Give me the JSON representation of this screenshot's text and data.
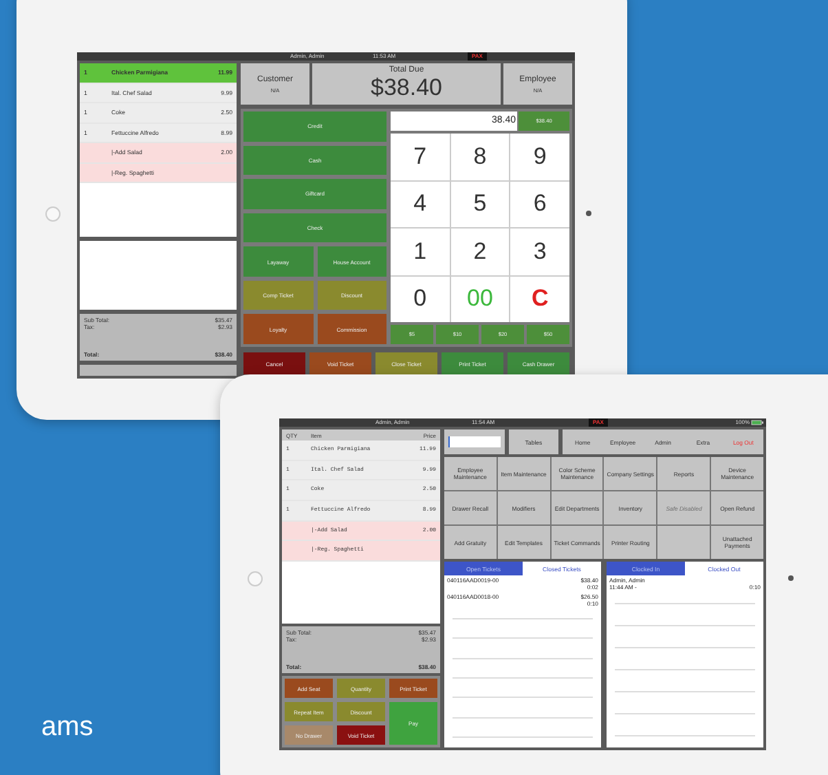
{
  "caption": "ams",
  "payment_screen": {
    "status": {
      "user": "Admin, Admin",
      "time": "11:53 AM",
      "badge": "PAX"
    },
    "order_items": [
      {
        "qty": "1",
        "name": "Chicken Parmigiana",
        "price": "11.99",
        "kind": "item",
        "selected": true
      },
      {
        "qty": "1",
        "name": "Ital. Chef Salad",
        "price": "9.99",
        "kind": "item",
        "selected": false
      },
      {
        "qty": "1",
        "name": "Coke",
        "price": "2.50",
        "kind": "item",
        "selected": false
      },
      {
        "qty": "1",
        "name": "Fettuccine Alfredo",
        "price": "8.99",
        "kind": "item",
        "selected": false
      },
      {
        "name": "|-Add Salad",
        "price": "2.00",
        "kind": "modifier",
        "selected": false
      },
      {
        "name": "|-Reg. Spaghetti",
        "kind": "modifier",
        "selected": false
      }
    ],
    "totals": [
      {
        "label": "Sub Total:",
        "value": "$35.47"
      },
      {
        "label": "Tax:",
        "value": "$2.93"
      },
      {
        "label": "Total:",
        "value": "$38.40",
        "kind": "grand"
      }
    ],
    "header": {
      "customer_label": "Customer",
      "customer_value": "N/A",
      "total_label": "Total Due",
      "total_value": "$38.40",
      "employee_label": "Employee",
      "employee_value": "N/A"
    },
    "payment_buttons": [
      {
        "label": "Credit",
        "color": "#3d8b3d",
        "kind": "wide"
      },
      {
        "label": "Cash",
        "color": "#3d8b3d",
        "kind": "wide"
      },
      {
        "label": "Giftcard",
        "color": "#3d8b3d",
        "kind": "wide"
      },
      {
        "label": "Check",
        "color": "#3d8b3d",
        "kind": "wide"
      },
      {
        "label": "Layaway",
        "color": "#3d8b3d",
        "kind": "half"
      },
      {
        "label": "House Account",
        "color": "#3d8b3d",
        "kind": "half"
      },
      {
        "label": "Comp Ticket",
        "color": "#8a8a2e",
        "kind": "half"
      },
      {
        "label": "Discount",
        "color": "#8a8a2e",
        "kind": "half"
      },
      {
        "label": "Loyalty",
        "color": "#9a4a1e",
        "kind": "half"
      },
      {
        "label": "Commission",
        "color": "#9a4a1e",
        "kind": "half"
      }
    ],
    "keypad": {
      "display": "38.40",
      "quick_amount": "$38.40",
      "keys": [
        {
          "label": "7",
          "kind": "digit"
        },
        {
          "label": "8",
          "kind": "digit"
        },
        {
          "label": "9",
          "kind": "digit"
        },
        {
          "label": "4",
          "kind": "digit"
        },
        {
          "label": "5",
          "kind": "digit"
        },
        {
          "label": "6",
          "kind": "digit"
        },
        {
          "label": "1",
          "kind": "digit"
        },
        {
          "label": "2",
          "kind": "digit"
        },
        {
          "label": "3",
          "kind": "digit"
        },
        {
          "label": "0",
          "kind": "digit"
        },
        {
          "label": "00",
          "kind": "double"
        },
        {
          "label": "C",
          "kind": "clear"
        }
      ],
      "presets": [
        "$5",
        "$10",
        "$20",
        "$50"
      ]
    },
    "actions": [
      {
        "label": "Cancel",
        "color": "#7a1010"
      },
      {
        "label": "Void Ticket",
        "color": "#9a4a1e"
      },
      {
        "label": "Close Ticket",
        "color": "#8a8a2e"
      },
      {
        "label": "Print Ticket",
        "color": "#3d8b3d"
      },
      {
        "label": "Cash Drawer",
        "color": "#3d8b3d"
      }
    ]
  },
  "main_screen": {
    "status": {
      "user": "Admin, Admin",
      "time": "11:54 AM",
      "badge": "PAX",
      "battery": "100%"
    },
    "columns": [
      "QTY",
      "Item",
      "Price"
    ],
    "order_items": [
      {
        "qty": "1",
        "name": "Chicken Parmigiana",
        "price": "11.99",
        "kind": "item"
      },
      {
        "qty": "1",
        "name": "Ital. Chef Salad",
        "price": "9.99",
        "kind": "item"
      },
      {
        "qty": "1",
        "name": "Coke",
        "price": "2.50",
        "kind": "item"
      },
      {
        "qty": "1",
        "name": "Fettuccine Alfredo",
        "price": "8.99",
        "kind": "item"
      },
      {
        "name": "|-Add Salad",
        "price": "2.00",
        "kind": "modifier"
      },
      {
        "name": "|-Reg. Spaghetti",
        "kind": "modifier"
      }
    ],
    "totals": [
      {
        "label": "Sub Total:",
        "value": "$35.47"
      },
      {
        "label": "Tax:",
        "value": "$2.93"
      },
      {
        "label": "Total:",
        "value": "$38.40",
        "kind": "grand"
      }
    ],
    "ticket_buttons": [
      {
        "label": "Add Seat",
        "color": "#9a4a1e",
        "kind": "normal"
      },
      {
        "label": "Quantity",
        "color": "#8a8a2e",
        "kind": "normal"
      },
      {
        "label": "Print Ticket",
        "color": "#9a4a1e",
        "kind": "normal"
      },
      {
        "label": "Repeat Item",
        "color": "#8a8a2e",
        "kind": "normal"
      },
      {
        "label": "Discount",
        "color": "#8a8a2e",
        "kind": "normal"
      },
      {
        "label": "Pay",
        "color": "#3fa33f",
        "kind": "tall"
      },
      {
        "label": "No Drawer",
        "color": "#a8896a",
        "kind": "normal"
      },
      {
        "label": "Void Ticket",
        "color": "#8a1010",
        "kind": "normal"
      }
    ],
    "tables_button": "Tables",
    "nav": [
      {
        "label": "Home",
        "kind": "normal"
      },
      {
        "label": "Employee",
        "kind": "normal"
      },
      {
        "label": "Admin",
        "kind": "normal"
      },
      {
        "label": "Extra",
        "kind": "normal"
      },
      {
        "label": "Log Out",
        "kind": "danger"
      }
    ],
    "functions": [
      {
        "label": "Employee Maintenance",
        "kind": "button",
        "disabled": false
      },
      {
        "label": "Item Maintenance",
        "kind": "button",
        "disabled": false
      },
      {
        "label": "Color Scheme Maintenance",
        "kind": "button",
        "disabled": false
      },
      {
        "label": "Company Settings",
        "kind": "button",
        "disabled": false
      },
      {
        "label": "Reports",
        "kind": "button",
        "disabled": false
      },
      {
        "label": "Device Maintenance",
        "kind": "button",
        "disabled": false
      },
      {
        "label": "Drawer Recall",
        "kind": "button",
        "disabled": false
      },
      {
        "label": "Modifiers",
        "kind": "button",
        "disabled": false
      },
      {
        "label": "Edit Departments",
        "kind": "button",
        "disabled": false
      },
      {
        "label": "Inventory",
        "kind": "button",
        "disabled": false
      },
      {
        "label": "Safe Disabled",
        "kind": "button",
        "disabled": true
      },
      {
        "label": "Open Refund",
        "kind": "button",
        "disabled": false
      },
      {
        "label": "Add Gratuity",
        "kind": "button",
        "disabled": false
      },
      {
        "label": "Edit Templates",
        "kind": "button",
        "disabled": false
      },
      {
        "label": "Ticket Commands",
        "kind": "button",
        "disabled": false
      },
      {
        "label": "Printer Routing",
        "kind": "button",
        "disabled": false
      },
      {
        "kind": "empty"
      },
      {
        "label": "Unattached Payments",
        "kind": "button",
        "disabled": false
      }
    ],
    "ticket_tabs": [
      {
        "label": "Open Tickets",
        "selected": true
      },
      {
        "label": "Closed Tickets",
        "selected": false
      }
    ],
    "tickets": [
      {
        "id": "040116AAD0019-00",
        "amount": "$38.40",
        "time": "0:02"
      },
      {
        "id": "040116AAD0018-00",
        "amount": "$26.50",
        "time": "0:10"
      }
    ],
    "clock_tabs": [
      {
        "label": "Clocked In",
        "selected": true
      },
      {
        "label": "Clocked Out",
        "selected": false
      }
    ],
    "clock_entries": [
      {
        "name": "Admin, Admin",
        "start": "11:44 AM -",
        "duration": "0:10"
      }
    ]
  }
}
